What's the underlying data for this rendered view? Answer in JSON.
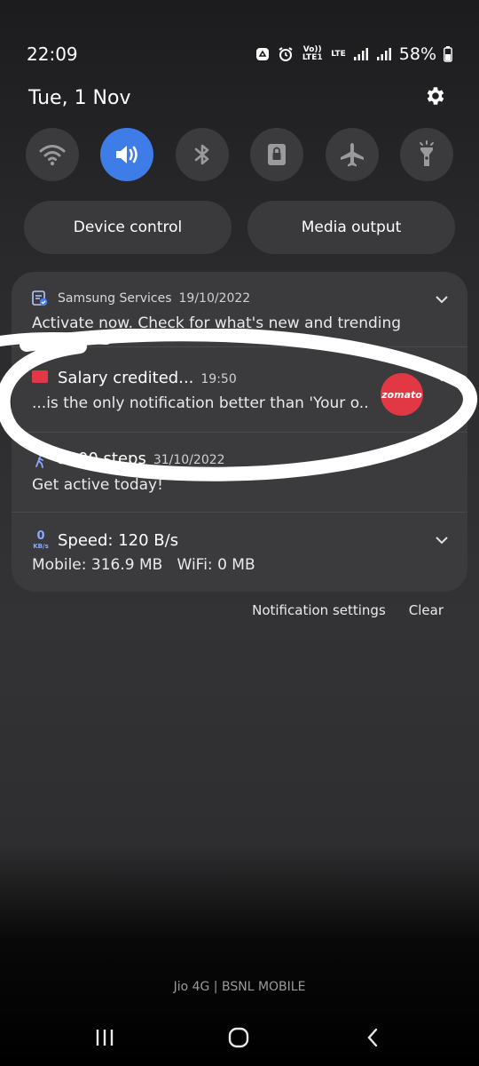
{
  "status_bar": {
    "time": "22:09",
    "volte_label": "Vo)) LTE1",
    "lte_label": "LTE",
    "battery_pct": "58%"
  },
  "header": {
    "date": "Tue, 1 Nov",
    "settings_icon": "gear-icon"
  },
  "quick_settings": [
    {
      "name": "wifi",
      "icon": "wifi-icon",
      "active": false
    },
    {
      "name": "sound",
      "icon": "speaker-icon",
      "active": true
    },
    {
      "name": "bluetooth",
      "icon": "bluetooth-icon",
      "active": false
    },
    {
      "name": "rotation-lock",
      "icon": "lock-icon",
      "active": false
    },
    {
      "name": "airplane",
      "icon": "airplane-icon",
      "active": false
    },
    {
      "name": "flashlight",
      "icon": "flashlight-icon",
      "active": false
    }
  ],
  "pills": {
    "device_control": "Device control",
    "media_output": "Media output"
  },
  "notifications": {
    "samsung": {
      "app": "Samsung Services",
      "time": "19/10/2022",
      "body": "Activate now. Check for what's new and trending"
    },
    "zomato": {
      "title": "Salary credited...",
      "time": "19:50",
      "body": "...is the only notification better than 'Your o..",
      "badge": "zomato"
    },
    "steps": {
      "title": "3000 steps",
      "time": "31/10/2022",
      "body": "Get active today!"
    },
    "speed": {
      "icon_value": "0",
      "icon_unit": "KB/s",
      "title": "Speed: 120 B/s",
      "body": "Mobile: 316.9 MB   WiFi: 0 MB"
    }
  },
  "footer": {
    "notification_settings": "Notification settings",
    "clear": "Clear"
  },
  "carrier": "Jio 4G | BSNL MOBILE",
  "colors": {
    "accent": "#3e7ce8",
    "zomato_red": "#e23744",
    "card_bg": "#3b3b3d"
  }
}
